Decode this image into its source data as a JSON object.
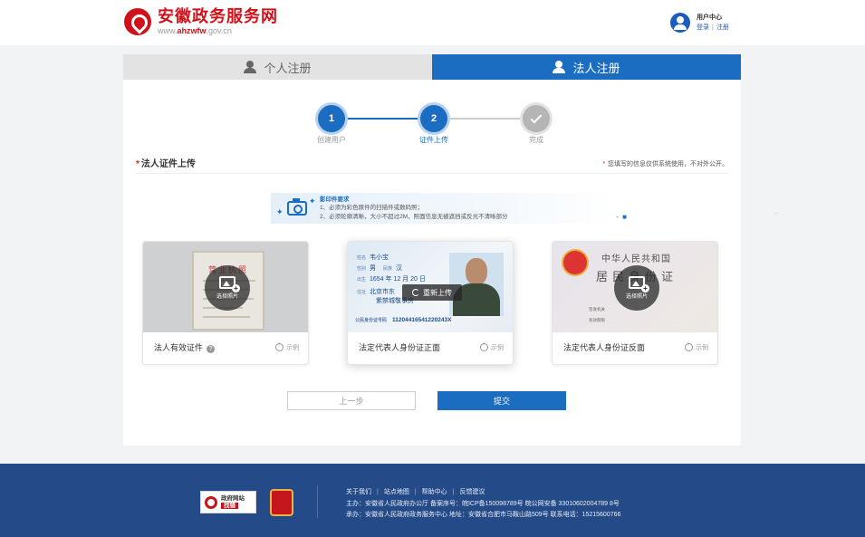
{
  "header": {
    "site_title": "安徽政务服务网",
    "site_url_prefix": "www.",
    "site_url_brand": "ahzwfw",
    "site_url_suffix": ".gov.cn",
    "user_center": {
      "title": "用户中心",
      "login": "登录",
      "separator": "|",
      "register": "注册"
    }
  },
  "tabs": {
    "personal": "个人注册",
    "legal": "法人注册",
    "active": "legal"
  },
  "stepper": {
    "steps": [
      {
        "number": "1",
        "label": "创建用户"
      },
      {
        "number": "2",
        "label": "证件上传"
      },
      {
        "number": "",
        "label": "完成"
      }
    ],
    "current": 2
  },
  "section": {
    "title": "法人证件上传",
    "required_mark": "*",
    "note": "您填写的信息仅供系统使用，不对外公开。"
  },
  "requirements": {
    "title": "影印件要求",
    "items": [
      "1、必须为彩色原件的扫描件或数码照；",
      "2、必须轮廓清晰，大小不超过2M，照面信息无被遮挡或反光不清晰部分"
    ]
  },
  "cards": [
    {
      "label": "法人有效证件",
      "has_help": true,
      "help_glyph": "?",
      "example": "示例",
      "overlay": "选择照片",
      "doc_title": "营业执照"
    },
    {
      "label": "法定代表人身份证正面",
      "example": "示例",
      "overlay": "重新上传",
      "id_fields": {
        "name_key": "姓名",
        "name": "韦小宝",
        "sex_key": "性别",
        "sex": "男",
        "ethnicity_key": "民族",
        "ethnicity": "汉",
        "birth_key": "出生",
        "birth": "1654 年 12 月 20 日",
        "address_key": "住址",
        "address_line1": "北京市东",
        "address_line2": "紫禁城敬事房",
        "id_key": "公民身份证号码",
        "id_number": "11204416541220243X"
      }
    },
    {
      "label": "法定代表人身份证反面",
      "example": "示例",
      "overlay": "选择照片",
      "back_title": "中华人民共和国",
      "back_subtitle": "居民身份证",
      "back_issuer_key": "签发机关",
      "back_valid_key": "有效期限"
    }
  ],
  "buttons": {
    "prev": "上一步",
    "submit": "提交"
  },
  "edge_dots": "..",
  "footer": {
    "gov_badge_line1": "政府网站",
    "gov_badge_line2": "找错",
    "links": [
      "关于我们",
      "站点地图",
      "帮助中心",
      "反馈建议"
    ],
    "link_separator": "|",
    "line2": "主办：安徽省人民政府办公厅 备案序号：皖ICP备150098789号   皖公网安备 33010602004789 8号",
    "line3": "承办：安徽省人民政府政务服务中心 地址：安徽省合肥市马鞍山路509号 联系电话：15215600766"
  },
  "colors": {
    "brand_red": "#d0121b",
    "primary_blue": "#1b6dc1",
    "footer_blue": "#244a87"
  }
}
